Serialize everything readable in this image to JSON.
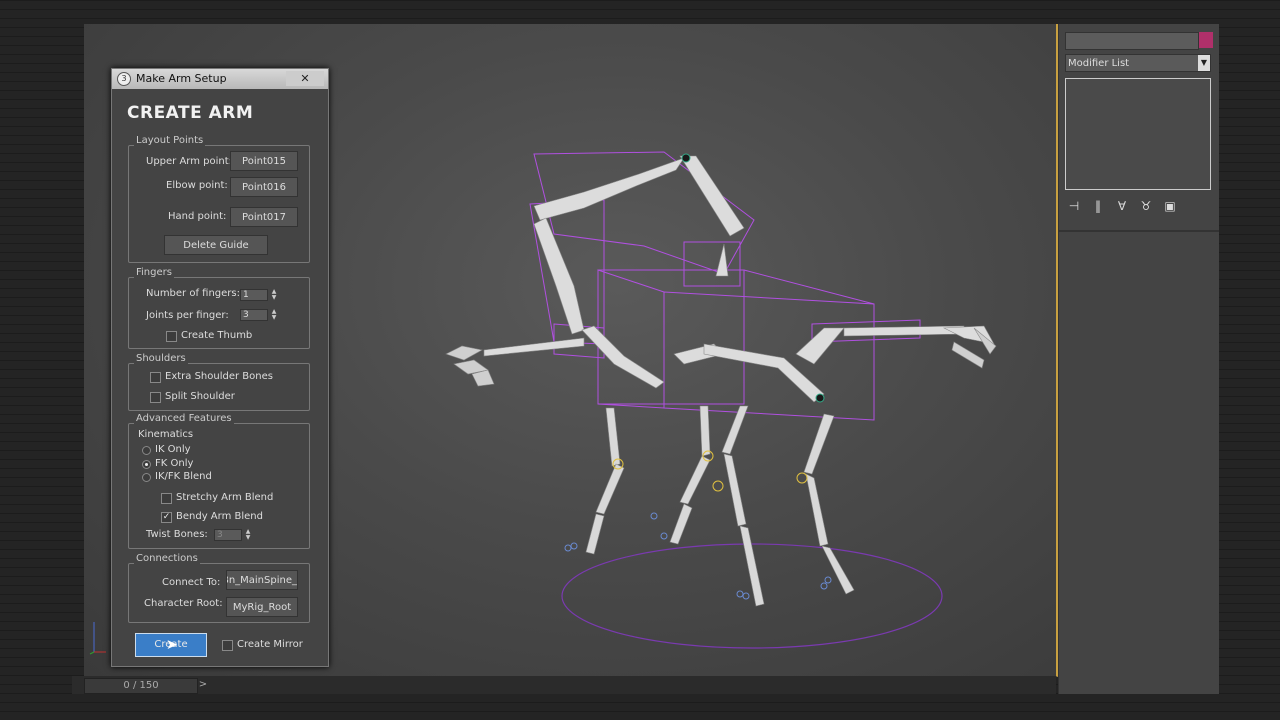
{
  "dialog": {
    "window_title": "Make Arm Setup",
    "close_glyph": "✕",
    "heading": "CREATE ARM",
    "layout_points": {
      "group_label": "Layout Points",
      "upper_arm_label": "Upper Arm point:",
      "upper_arm_value": "Point015",
      "elbow_label": "Elbow point:",
      "elbow_value": "Point016",
      "hand_label": "Hand point:",
      "hand_value": "Point017",
      "delete_guide": "Delete Guide"
    },
    "fingers": {
      "group_label": "Fingers",
      "number_label": "Number of fingers:",
      "number_value": "1",
      "joints_label": "Joints per finger:",
      "joints_value": "3",
      "create_thumb_label": "Create Thumb",
      "create_thumb_checked": false
    },
    "shoulders": {
      "group_label": "Shoulders",
      "extra_label": "Extra Shoulder Bones",
      "split_label": "Split Shoulder"
    },
    "advanced": {
      "group_label": "Advanced Features",
      "kinematics_label": "Kinematics",
      "ik_only": "IK Only",
      "fk_only": "FK Only",
      "ikfk_blend": "IK/FK Blend",
      "selected": "fk_only",
      "stretchy_label": "Stretchy Arm Blend",
      "bendy_label": "Bendy Arm Blend",
      "bendy_checked": true,
      "twist_label": "Twist Bones:",
      "twist_value": "3"
    },
    "connections": {
      "group_label": "Connections",
      "connect_label": "Connect To:",
      "connect_value": "_Bn_MainSpine",
      "root_label": "Character Root:",
      "root_value": "MyRig_Root"
    },
    "create_button": "Create",
    "create_mirror_label": "Create Mirror"
  },
  "command_panel": {
    "modifier_list": "Modifier List",
    "name_swatch_color": "#b0306a"
  },
  "timeline": {
    "frame_counter": "0 / 150",
    "next_glyph": ">"
  },
  "colors": {
    "bone": "#d8d8d8",
    "bone_shadow": "#8a8a8a",
    "guide_purple": "#a040d0",
    "accent_blue": "#3a7ec8"
  }
}
